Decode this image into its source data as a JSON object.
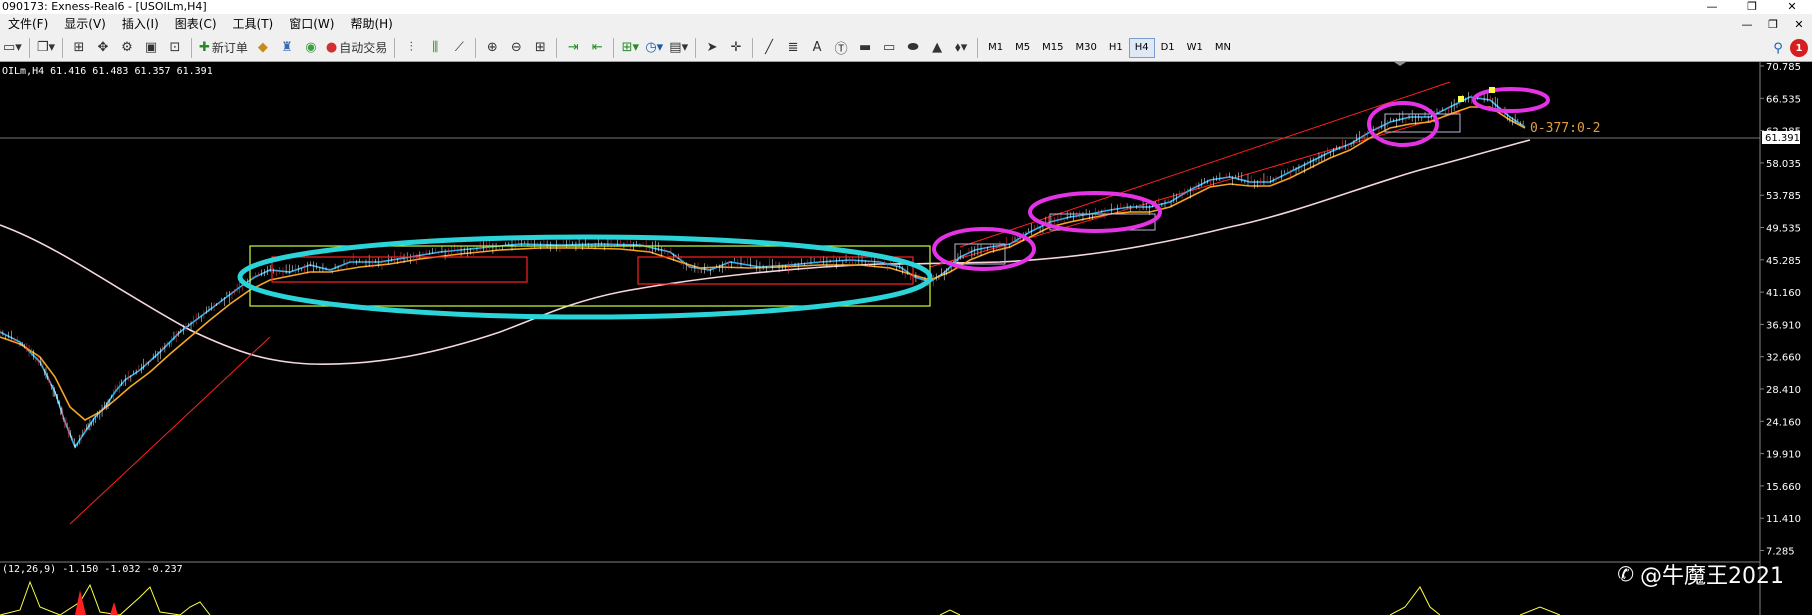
{
  "window": {
    "title": "090173: Exness-Real6 - [USOILm,H4]",
    "controls": [
      "—",
      "❐",
      "✕"
    ]
  },
  "menu": {
    "items": [
      "文件(F)",
      "显示(V)",
      "插入(I)",
      "图表(C)",
      "工具(T)",
      "窗口(W)",
      "帮助(H)"
    ],
    "right_controls": [
      "—",
      "❐",
      "✕"
    ]
  },
  "toolbar": {
    "new_order": "新订单",
    "auto_trade": "自动交易",
    "text_tool": "A",
    "timeframes": [
      "M1",
      "M5",
      "M15",
      "M30",
      "H1",
      "H4",
      "D1",
      "W1",
      "MN"
    ],
    "active_timeframe": "H4",
    "notification_count": "1"
  },
  "chart": {
    "symbol_info": "OILm,H4  61.416 61.483 61.357 61.391",
    "indicator_info": "(12,26,9) -1.150 -1.032 -0.237",
    "annotation": "0-377:0-2",
    "current_price": "61.391",
    "price_labels": [
      "70.785",
      "66.535",
      "62.285",
      "58.035",
      "53.785",
      "49.535",
      "45.285",
      "41.160",
      "36.910",
      "32.660",
      "28.410",
      "24.160",
      "19.910",
      "15.660",
      "11.410",
      "7.285"
    ],
    "watermark": "@牛魔王2021"
  },
  "colors": {
    "background": "#000000",
    "ema_fast": "#29b6f6",
    "ema_slow": "#f5a623",
    "ma_long": "#f3d6e0",
    "channel": "#ff2020",
    "box_green": "#c8ff3c",
    "box_red": "#ff2020",
    "ellipse_cyan": "#2ad4d8",
    "ellipse_magenta": "#e433e4"
  }
}
